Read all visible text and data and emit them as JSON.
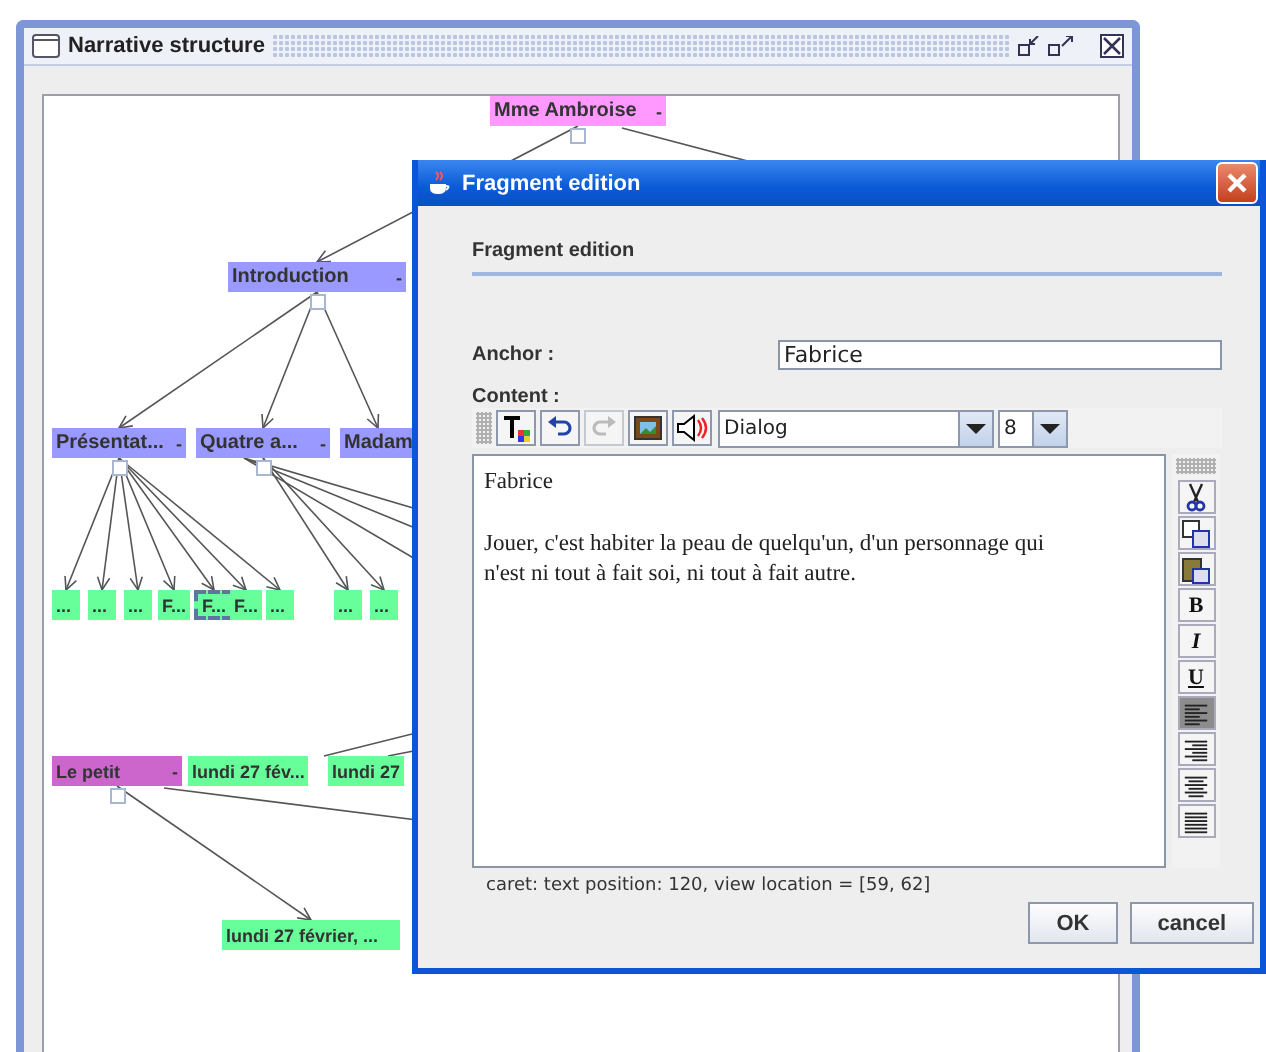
{
  "window": {
    "title": "Narrative structure"
  },
  "diagram": {
    "nodes": [
      {
        "label": "Mme Ambroise",
        "toggle": "-",
        "color": "#ff99ff",
        "selected": false,
        "children": [
          {
            "label": "Introduction",
            "toggle": "-",
            "color": "#9999ff",
            "selected": false,
            "children": [
              {
                "label": "Présentat...",
                "toggle": "-",
                "color": "#9999ff",
                "selected": false,
                "children": [
                  {
                    "label": "...",
                    "color": "#66ff99",
                    "selected": false
                  },
                  {
                    "label": "...",
                    "color": "#66ff99",
                    "selected": false
                  },
                  {
                    "label": "...",
                    "color": "#66ff99",
                    "selected": false
                  },
                  {
                    "label": "F...",
                    "color": "#66ff99",
                    "selected": false
                  },
                  {
                    "label": "F...",
                    "color": "#66ff99",
                    "selected": true
                  },
                  {
                    "label": "F...",
                    "color": "#66ff99",
                    "selected": false
                  },
                  {
                    "label": "...",
                    "color": "#66ff99",
                    "selected": false
                  }
                ]
              },
              {
                "label": "Quatre a...",
                "toggle": "-",
                "color": "#9999ff",
                "selected": false,
                "children": [
                  {
                    "label": "...",
                    "color": "#66ff99",
                    "selected": false
                  },
                  {
                    "label": "...",
                    "color": "#66ff99",
                    "selected": false
                  }
                ]
              },
              {
                "label": "Madam",
                "color": "#9999ff",
                "selected": false
              }
            ]
          }
        ]
      },
      {
        "label": "Le petit",
        "toggle": "-",
        "color": "#cc66cc",
        "selected": false,
        "children": [
          {
            "label": "lundi 27 février, ...",
            "color": "#66ff99",
            "selected": false
          }
        ]
      },
      {
        "label": "lundi 27 fév...",
        "color": "#66ff99",
        "selected": false
      },
      {
        "label": "lundi 27",
        "color": "#66ff99",
        "selected": false
      }
    ]
  },
  "dialog": {
    "title": "Fragment edition",
    "heading": "Fragment edition",
    "anchor": {
      "label": "Anchor :",
      "value": "Fabrice"
    },
    "content_label": "Content :",
    "toolbar": [
      {
        "kind": "text-color",
        "disabled": false
      },
      {
        "kind": "undo",
        "disabled": false
      },
      {
        "kind": "redo",
        "disabled": true
      },
      {
        "kind": "image",
        "disabled": false
      },
      {
        "kind": "sound",
        "disabled": false
      }
    ],
    "font": {
      "value": "Dialog"
    },
    "size": {
      "value": "8"
    },
    "paragraphs": [
      "Fabrice",
      "Jouer, c'est habiter la peau de quelqu'un, d'un personnage qui n'est ni tout à fait soi, ni tout à fait autre."
    ],
    "side_toolbar": [
      {
        "kind": "cut"
      },
      {
        "kind": "copy"
      },
      {
        "kind": "paste"
      },
      {
        "kind": "bold",
        "label": "B"
      },
      {
        "kind": "italic",
        "label": "I"
      },
      {
        "kind": "underline",
        "label": "U"
      },
      {
        "kind": "align-left",
        "selected": true
      },
      {
        "kind": "align-right",
        "selected": false
      },
      {
        "kind": "align-center",
        "selected": false
      },
      {
        "kind": "align-justify",
        "selected": false
      }
    ],
    "status": "caret: text position: 120, view location = [59, 62]",
    "buttons": [
      {
        "label": "OK"
      },
      {
        "label": "cancel"
      }
    ]
  }
}
